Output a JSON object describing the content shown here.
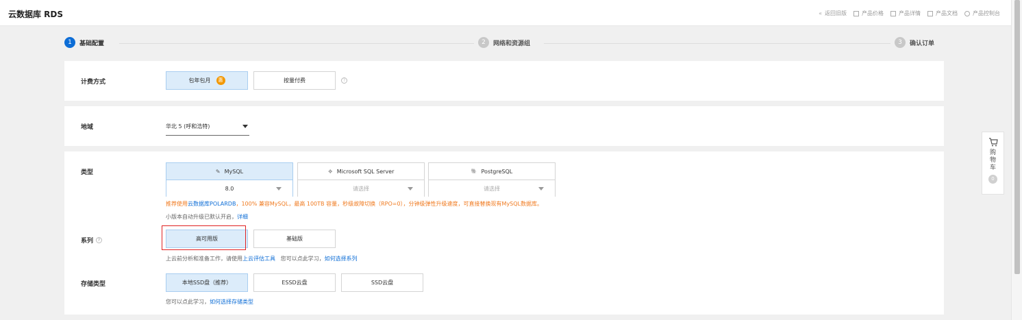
{
  "app": {
    "title": "云数据库 RDS"
  },
  "toplinks": [
    {
      "icon": "«",
      "label": "返回旧版"
    },
    {
      "icon": "▤",
      "label": "产品价格"
    },
    {
      "icon": "▣",
      "label": "产品详情"
    },
    {
      "icon": "▢",
      "label": "产品文档"
    },
    {
      "icon": "⚙",
      "label": "产品控制台"
    }
  ],
  "steps": [
    {
      "num": "1",
      "label": "基础配置"
    },
    {
      "num": "2",
      "label": "网络和资源组"
    },
    {
      "num": "3",
      "label": "确认订单"
    }
  ],
  "billing": {
    "label": "计费方式",
    "options": [
      "包年包月",
      "按量付费"
    ],
    "badge": "惠",
    "help": "?"
  },
  "region": {
    "label": "地域",
    "value": "华北 5 (呼和浩特)"
  },
  "type": {
    "label": "类型",
    "engines": [
      {
        "icon": "✎",
        "name": "MySQL",
        "version": "8.0"
      },
      {
        "icon": "❖",
        "name": "Microsoft SQL Server",
        "version": "请选择"
      },
      {
        "icon": "🐘",
        "name": "PostgreSQL",
        "version": "请选择"
      }
    ],
    "promo_prefix": "推荐使用",
    "promo_link": "云数据库POLARDB",
    "promo_suffix": "，100% 兼容MySQL，最高 100TB 容量，秒级故障切换（RPO=0），分钟级弹性升级速度，可直接替换现有MySQL数据库。",
    "upgrade_note": "小版本自动升级已默认开启，",
    "upgrade_link": "详细"
  },
  "series": {
    "label": "系列",
    "help": "?",
    "options": [
      "高可用版",
      "基础版"
    ],
    "note_prefix": "上云前分析和准备工作，请使用",
    "note_link1": "上云评估工具",
    "note_middle": "   您可以点此学习，",
    "note_link2": "如何选择系列"
  },
  "storage": {
    "label": "存储类型",
    "options": [
      "本地SSD盘（推荐）",
      "ESSD云盘",
      "SSD云盘"
    ],
    "note_prefix": "您可以点此学习，",
    "note_link": "如何选择存储类型"
  },
  "cart": {
    "label": "购物车",
    "count": "0"
  },
  "colors": {
    "accent": "#0d6dd6",
    "selected_bg": "#dcecfa",
    "promo": "#f07a1f",
    "highlight": "#e02020"
  }
}
